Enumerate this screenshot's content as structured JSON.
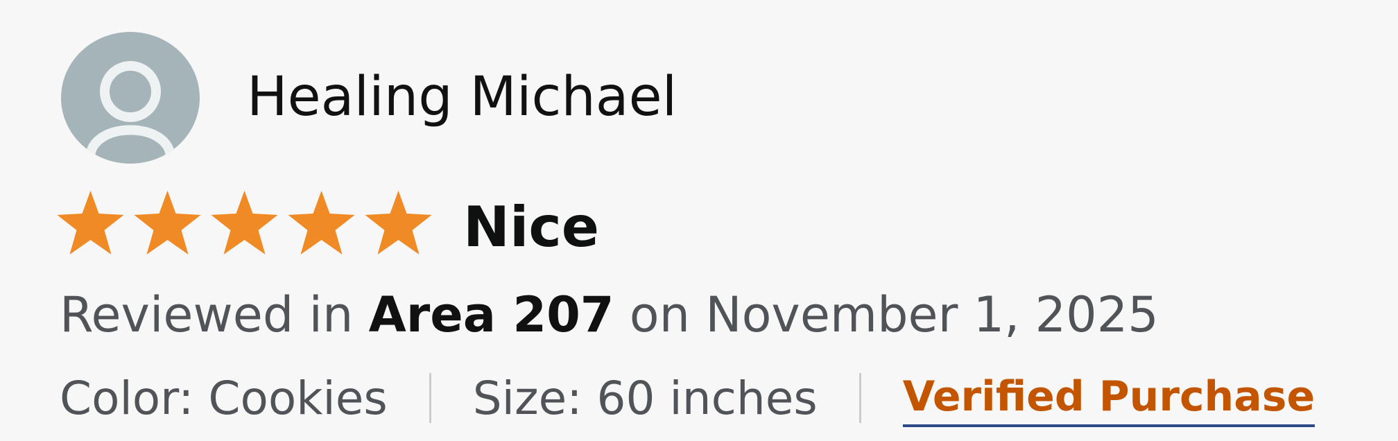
{
  "review": {
    "reviewer_name": "Healing Michael",
    "avatar_icon": "default-user-avatar-icon",
    "rating": {
      "value": 5,
      "max": 5,
      "star_color": "#f08a24"
    },
    "title": "Nice",
    "meta": {
      "prefix": "Reviewed in",
      "region": "Area 207",
      "date_text": "on November 1, 2025"
    },
    "variant": {
      "color": "Color: Cookies",
      "size": "Size: 60 inches"
    },
    "badge": {
      "label": "Verified Purchase",
      "color": "#c45500"
    }
  }
}
